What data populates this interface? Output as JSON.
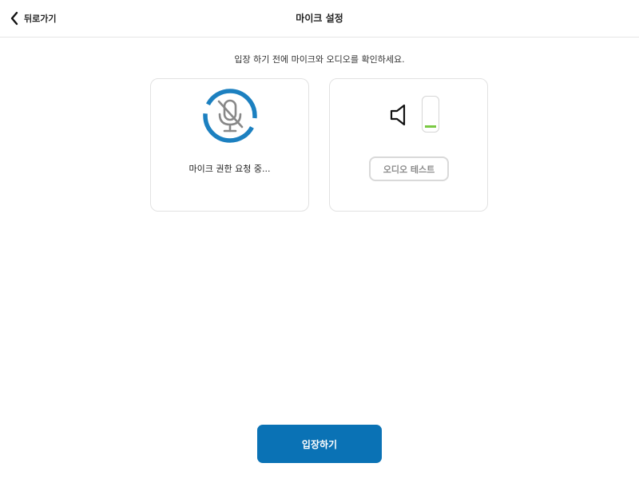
{
  "header": {
    "back_label": "뒤로가기",
    "title": "마이크 설정"
  },
  "instruction": "입장 하기 전에 마이크와 오디오를 확인하세요.",
  "mic_card": {
    "icon": "mic-off-icon",
    "status": "마이크 권한 요청 중..."
  },
  "audio_card": {
    "icon": "speaker-icon",
    "level": 0.1,
    "test_button_label": "오디오 테스트"
  },
  "enter_button_label": "입장하기",
  "colors": {
    "accent": "#0a72b5",
    "spinner": "#1c80c0",
    "level": "#7ac943",
    "mic_icon": "#888888"
  }
}
